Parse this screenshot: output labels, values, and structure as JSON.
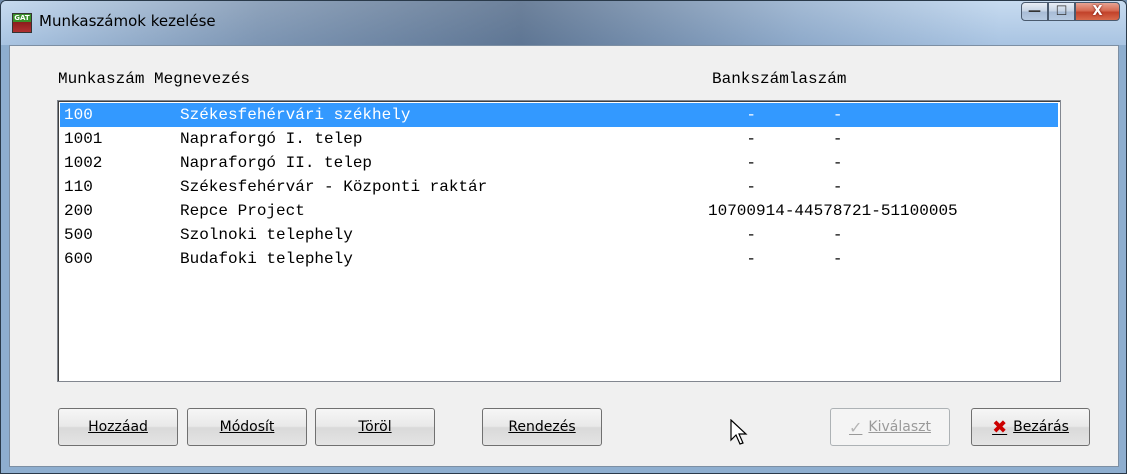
{
  "window": {
    "title": "Munkaszámok kezelése",
    "app_icon_text": "GAT",
    "caption": {
      "minimize": "—",
      "maximize": "☐",
      "close": "X"
    }
  },
  "list": {
    "headers": {
      "code_name": "Munkaszám Megnevezés",
      "bank": "Bankszámlaszám"
    },
    "rows": [
      {
        "code": "100",
        "name": "Székesfehérvári székhely",
        "bank": "    -        -",
        "selected": true
      },
      {
        "code": "1001",
        "name": "Napraforgó I. telep",
        "bank": "    -        -",
        "selected": false
      },
      {
        "code": "1002",
        "name": "Napraforgó II. telep",
        "bank": "    -        -",
        "selected": false
      },
      {
        "code": "110",
        "name": "Székesfehérvár - Központi raktár",
        "bank": "    -        -",
        "selected": false
      },
      {
        "code": "200",
        "name": "Repce Project",
        "bank": "10700914-44578721-51100005",
        "selected": false
      },
      {
        "code": "500",
        "name": "Szolnoki telephely",
        "bank": "    -        -",
        "selected": false
      },
      {
        "code": "600",
        "name": "Budafoki telephely",
        "bank": "    -        -",
        "selected": false
      }
    ]
  },
  "buttons": {
    "add": "Hozzáad",
    "modify": "Módosít",
    "delete": "Töröl",
    "sort": "Rendezés",
    "select": "Kiválaszt",
    "close": "Bezárás"
  },
  "colors": {
    "selection": "#3399ff",
    "close_icon": "#cc0000"
  }
}
